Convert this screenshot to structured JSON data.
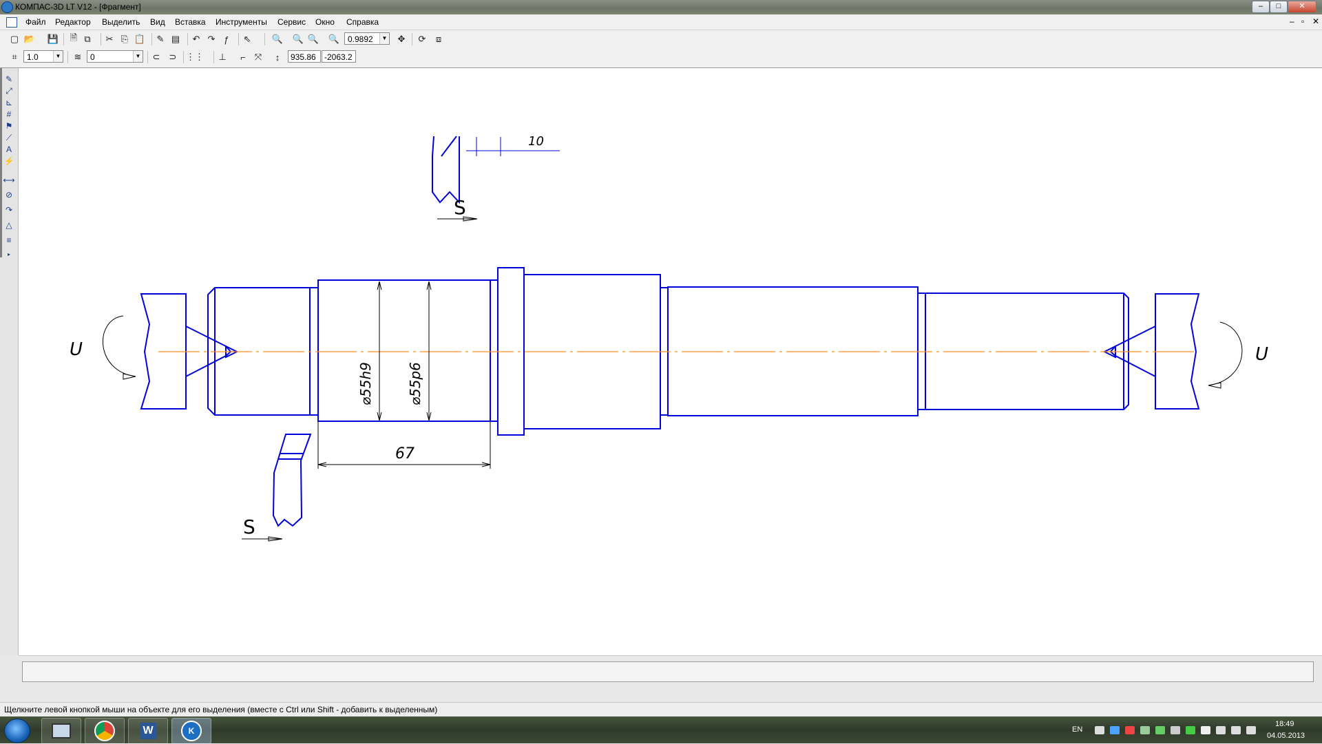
{
  "window": {
    "title": "КОМПАС-3D LT V12 - [Фрагмент]",
    "min_label": "‒",
    "max_label": "□",
    "close_label": "✕"
  },
  "menu": {
    "items": [
      "Файл",
      "Редактор",
      "Выделить",
      "Вид",
      "Вставка",
      "Инструменты",
      "Сервис",
      "Окно",
      "Справка"
    ],
    "mdi_min": "‒",
    "mdi_restore": "▫",
    "mdi_close": "✕"
  },
  "toolbar1": {
    "zoom_value": "0.9892"
  },
  "toolbar2": {
    "step_value": "1.0",
    "layer_value": "0",
    "coord_x": "935.86",
    "coord_y": "-2063.2"
  },
  "drawing": {
    "top_dim_text": "10",
    "tool_label_top": "S",
    "tool_label_bottom": "S",
    "rotation_left": "U",
    "rotation_right": "U",
    "dim_diameter_1": "⌀55h9",
    "dim_diameter_2": "⌀55p6",
    "dim_length": "67",
    "line_color": "#0000dd",
    "axis_color": "#ff8c1a"
  },
  "status": {
    "hint": "Щелкните левой кнопкой мыши на объекте для его выделения (вместе с Ctrl или Shift - добавить к выделенным)"
  },
  "taskbar": {
    "language": "EN",
    "time": "18:49",
    "date": "04.05.2013",
    "apps": [
      "task-manager",
      "chrome",
      "word",
      "kompas"
    ]
  }
}
